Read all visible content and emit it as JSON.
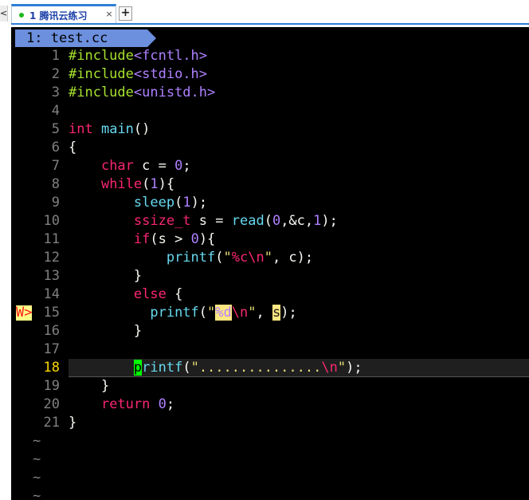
{
  "window_tabs": {
    "prev_glyph": "<",
    "active_tab": {
      "index": "1",
      "title": "腾讯云练习",
      "status_color": "#1fb81f"
    },
    "close_glyph": "×",
    "new_tab_glyph": "+"
  },
  "editor": {
    "buffer_tab": "1: test.cc",
    "current_line": "18",
    "sign": {
      "line": "15",
      "text": "W>"
    },
    "lines": [
      {
        "num": "1",
        "text": "#include<fcntl.h>"
      },
      {
        "num": "2",
        "text": "#include<stdio.h>"
      },
      {
        "num": "3",
        "text": "#include<unistd.h>"
      },
      {
        "num": "4",
        "text": ""
      },
      {
        "num": "5",
        "text": "int main()"
      },
      {
        "num": "6",
        "text": "{"
      },
      {
        "num": "7",
        "text": "    char c = 0;"
      },
      {
        "num": "8",
        "text": "    while(1){"
      },
      {
        "num": "9",
        "text": "        sleep(1);"
      },
      {
        "num": "10",
        "text": "        ssize_t s = read(0,&c,1);"
      },
      {
        "num": "11",
        "text": "        if(s > 0){"
      },
      {
        "num": "12",
        "text": "            printf(\"%c\\n\", c);"
      },
      {
        "num": "13",
        "text": "        }"
      },
      {
        "num": "14",
        "text": "        else {"
      },
      {
        "num": "15",
        "text": "          printf(\"%d\\n\", s);"
      },
      {
        "num": "16",
        "text": "        }"
      },
      {
        "num": "17",
        "text": ""
      },
      {
        "num": "18",
        "text": "        printf(\"...............\\n\");"
      },
      {
        "num": "19",
        "text": "    }"
      },
      {
        "num": "20",
        "text": "    return 0;"
      },
      {
        "num": "21",
        "text": "}"
      }
    ],
    "tilde": "~",
    "colors": {
      "background": "#000000",
      "preprocessor": "#a6e22e",
      "keyword": "#f92672",
      "function": "#66d9ef",
      "number": "#ae81ff",
      "string": "#e6db74",
      "line_number": "#808080",
      "current_line_number": "#ffd700",
      "buffer_tab": "#6c8fde",
      "warning_sign_bg": "#ffff87",
      "warning_sign_fg": "#ff1a1a"
    }
  }
}
